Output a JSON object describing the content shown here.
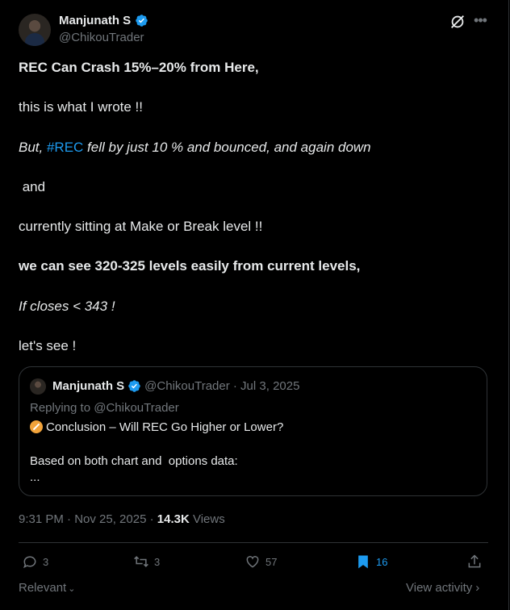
{
  "author": {
    "name": "Manjunath S",
    "handle": "@ChikouTrader"
  },
  "post": {
    "line1": "REC Can Crash 15%–20% from Here,",
    "line2": "this is what I wrote !!",
    "line3_prefix": "But, ",
    "line3_hashtag": "#REC",
    "line3_suffix": " fell by just 10 % and bounced, and again down",
    "line4": " and",
    "line5": "currently sitting at Make or Break level !!",
    "line6": "we can see 320-325 levels easily from current levels,",
    "line7": "If closes < 343 !",
    "line8": "let's see !"
  },
  "quote": {
    "name": "Manjunath S",
    "meta": "@ChikouTrader · Jul 3, 2025",
    "replying": "Replying to @ChikouTrader",
    "emoji": "compass-emoji",
    "line1": "Conclusion – Will REC Go Higher or Lower?",
    "line2": "Based on both chart and  options data:",
    "line3": "..."
  },
  "meta": {
    "timestamp": "9:31 PM · Nov 25, 2025 · ",
    "views_count": "14.3K",
    "views_label": " Views"
  },
  "actions": {
    "replies": "3",
    "reposts": "3",
    "likes": "57",
    "bookmarks": "16"
  },
  "footer": {
    "relevant": "Relevant",
    "view_activity": "View activity"
  },
  "colors": {
    "accent": "#1d9bf0",
    "text": "#e7e9ea",
    "muted": "#71767b",
    "border": "#2f3336"
  }
}
